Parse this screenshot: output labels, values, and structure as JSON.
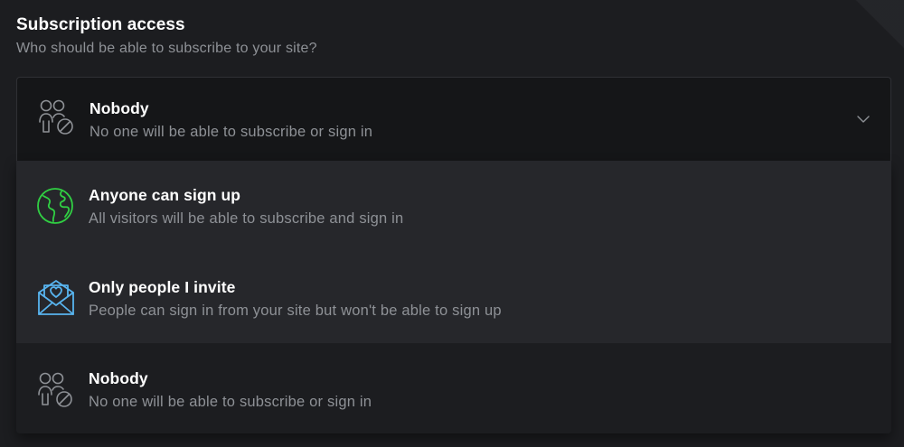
{
  "section": {
    "title": "Subscription access",
    "description": "Who should be able to subscribe to your site?"
  },
  "select": {
    "selected": {
      "icon": "people-blocked-icon",
      "title": "Nobody",
      "description": "No one will be able to subscribe or sign in"
    },
    "chevron_icon": "chevron-down-icon"
  },
  "options": [
    {
      "icon": "globe-icon",
      "icon_color": "#30cf43",
      "title": "Anyone can sign up",
      "description": "All visitors will be able to subscribe and sign in"
    },
    {
      "icon": "envelope-heart-icon",
      "icon_color": "#58b4ef",
      "title": "Only people I invite",
      "description": "People can sign in from your site but won't be able to sign up"
    },
    {
      "icon": "people-blocked-icon",
      "icon_color": "#8e9196",
      "title": "Nobody",
      "description": "No one will be able to subscribe or sign in"
    }
  ],
  "colors": {
    "background": "#1c1d20",
    "select_background": "#151618",
    "option_background": "#26272b",
    "muted_text": "#8e9196"
  }
}
